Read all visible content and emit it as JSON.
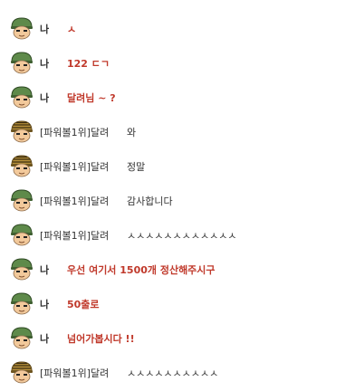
{
  "colors": {
    "me_text": "#c0392b",
    "other_text": "#333333",
    "background": "#ffffff"
  },
  "messages": [
    {
      "sender": "나",
      "is_me": true,
      "avatar": "green-helmet-soldier-icon",
      "text": "ㅅ"
    },
    {
      "sender": "나",
      "is_me": true,
      "avatar": "green-helmet-soldier-icon",
      "text": "122 ㄷㄱ"
    },
    {
      "sender": "나",
      "is_me": true,
      "avatar": "green-helmet-soldier-icon",
      "text": "달려님 ~ ?"
    },
    {
      "sender": "[파워볼1위]달려",
      "is_me": false,
      "avatar": "striped-helmet-soldier-icon",
      "text": "와"
    },
    {
      "sender": "[파워볼1위]달려",
      "is_me": false,
      "avatar": "striped-helmet-soldier-icon",
      "text": "정말"
    },
    {
      "sender": "[파워볼1위]달려",
      "is_me": false,
      "avatar": "green-helmet-soldier-icon",
      "text": "감사합니다"
    },
    {
      "sender": "[파워볼1위]달려",
      "is_me": false,
      "avatar": "green-helmet-soldier-icon",
      "text": "ㅅㅅㅅㅅㅅㅅㅅㅅㅅㅅㅅㅅ"
    },
    {
      "sender": "나",
      "is_me": true,
      "avatar": "green-helmet-soldier-icon",
      "text": "우선 여기서 1500개 정산해주시구"
    },
    {
      "sender": "나",
      "is_me": true,
      "avatar": "green-helmet-soldier-icon",
      "text": "50출로"
    },
    {
      "sender": "나",
      "is_me": true,
      "avatar": "green-helmet-soldier-icon",
      "text": "넘어가봅시다 !!"
    },
    {
      "sender": "[파워볼1위]달려",
      "is_me": false,
      "avatar": "striped-helmet-soldier-icon",
      "text": "ㅅㅅㅅㅅㅅㅅㅅㅅㅅㅅ"
    }
  ]
}
